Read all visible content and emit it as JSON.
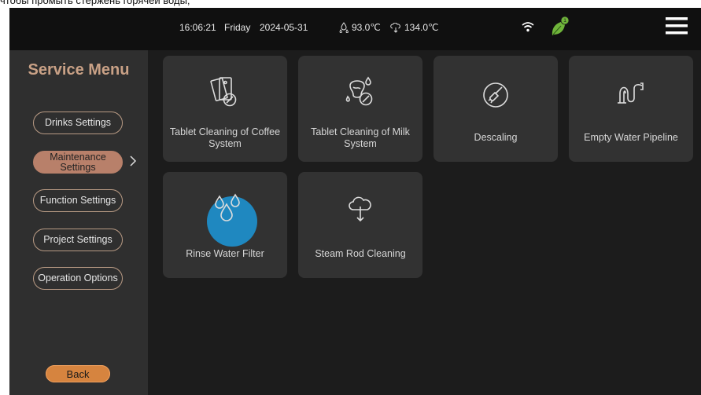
{
  "caption": "чтобы промыть стержень горячей воды;",
  "status_bar": {
    "time": "16:06:21",
    "day": "Friday",
    "date": "2024-05-31",
    "water_temp": "93.0℃",
    "steam_temp": "134.0℃",
    "icons": [
      "water-temperature-icon",
      "steam-temperature-icon",
      "wifi-icon",
      "leaf-icon",
      "menu-icon"
    ],
    "leaf_badge": "1"
  },
  "sidebar": {
    "title": "Service Menu",
    "items": [
      {
        "label": "Drinks Settings",
        "active": false
      },
      {
        "label": "Maintenance Settings",
        "active": true
      },
      {
        "label": "Function Settings",
        "active": false
      },
      {
        "label": "Project Settings",
        "active": false
      },
      {
        "label": "Operation Options",
        "active": false
      }
    ],
    "back_label": "Back"
  },
  "tiles": [
    {
      "label": "Tablet Cleaning of Coffee System",
      "icon": "coffee-tablet-cleaning-icon"
    },
    {
      "label": "Tablet Cleaning of Milk System",
      "icon": "milk-tablet-cleaning-icon"
    },
    {
      "label": "Descaling",
      "icon": "descaling-brush-icon"
    },
    {
      "label": "Empty Water Pipeline",
      "icon": "pipeline-icon"
    },
    {
      "label": "Rinse Water Filter",
      "icon": "water-drops-icon"
    },
    {
      "label": "Steam Rod Cleaning",
      "icon": "steam-cloud-icon"
    }
  ],
  "colors": {
    "background": "#1c1c1c",
    "sidebar": "#2f2f2f",
    "tile": "#323232",
    "accent": "#c9a186",
    "active_pill": "#b8806a",
    "back_button": "#d6843f",
    "leaf": "#6fb43a",
    "touch_indicator": "#1f88c0"
  }
}
